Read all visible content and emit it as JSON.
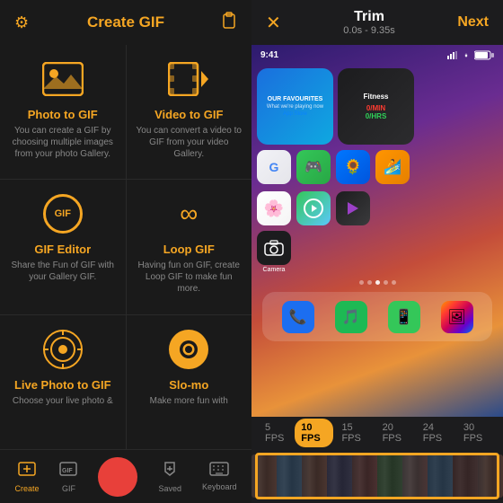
{
  "left": {
    "header": {
      "title": "Create GIF",
      "gear_icon": "⚙",
      "clipboard_icon": "📋"
    },
    "grid": [
      {
        "id": "photo-to-gif",
        "title": "Photo to GIF",
        "desc": "You can create a GIF by choosing multiple images from your photo Gallery.",
        "icon_type": "image"
      },
      {
        "id": "video-to-gif",
        "title": "Video to GIF",
        "desc": "You can convert a video to GIF from your video Gallery.",
        "icon_type": "video"
      },
      {
        "id": "gif-editor",
        "title": "GIF Editor",
        "desc": "Share the Fun of GIF with your Gallery GIF.",
        "icon_type": "gif"
      },
      {
        "id": "loop-gif",
        "title": "Loop GIF",
        "desc": "Having fun on GIF, create Loop GIF to make fun more.",
        "icon_type": "loop"
      },
      {
        "id": "live-photo-to-gif",
        "title": "Live Photo to GIF",
        "desc": "Choose your live photo &",
        "icon_type": "live"
      },
      {
        "id": "slo-mo",
        "title": "Slo-mo",
        "desc": "Make more fun with",
        "icon_type": "slomo"
      }
    ],
    "bottom_nav": [
      {
        "id": "create",
        "label": "Create",
        "active": true,
        "icon": "➕"
      },
      {
        "id": "gif",
        "label": "GIF",
        "active": false,
        "icon": "🖼"
      },
      {
        "id": "record",
        "label": "",
        "active": false,
        "icon": ""
      },
      {
        "id": "saved",
        "label": "Saved",
        "active": false,
        "icon": "⬇"
      },
      {
        "id": "keyboard",
        "label": "Keyboard",
        "active": false,
        "icon": "⌨"
      }
    ]
  },
  "right": {
    "header": {
      "close_icon": "✕",
      "title": "Trim",
      "subtitle": "0.0s - 9.35s",
      "next_label": "Next"
    },
    "fps_options": [
      {
        "value": "5 FPS",
        "active": false
      },
      {
        "value": "10 FPS",
        "active": true
      },
      {
        "value": "15 FPS",
        "active": false
      },
      {
        "value": "20 FPS",
        "active": false
      },
      {
        "value": "24 FPS",
        "active": false
      },
      {
        "value": "30 FPS",
        "active": false
      }
    ],
    "phone_preview": {
      "status_time": "9:41",
      "status_signal": "▌▌▌",
      "status_wifi": "WiFi",
      "status_battery": "🔋"
    }
  }
}
